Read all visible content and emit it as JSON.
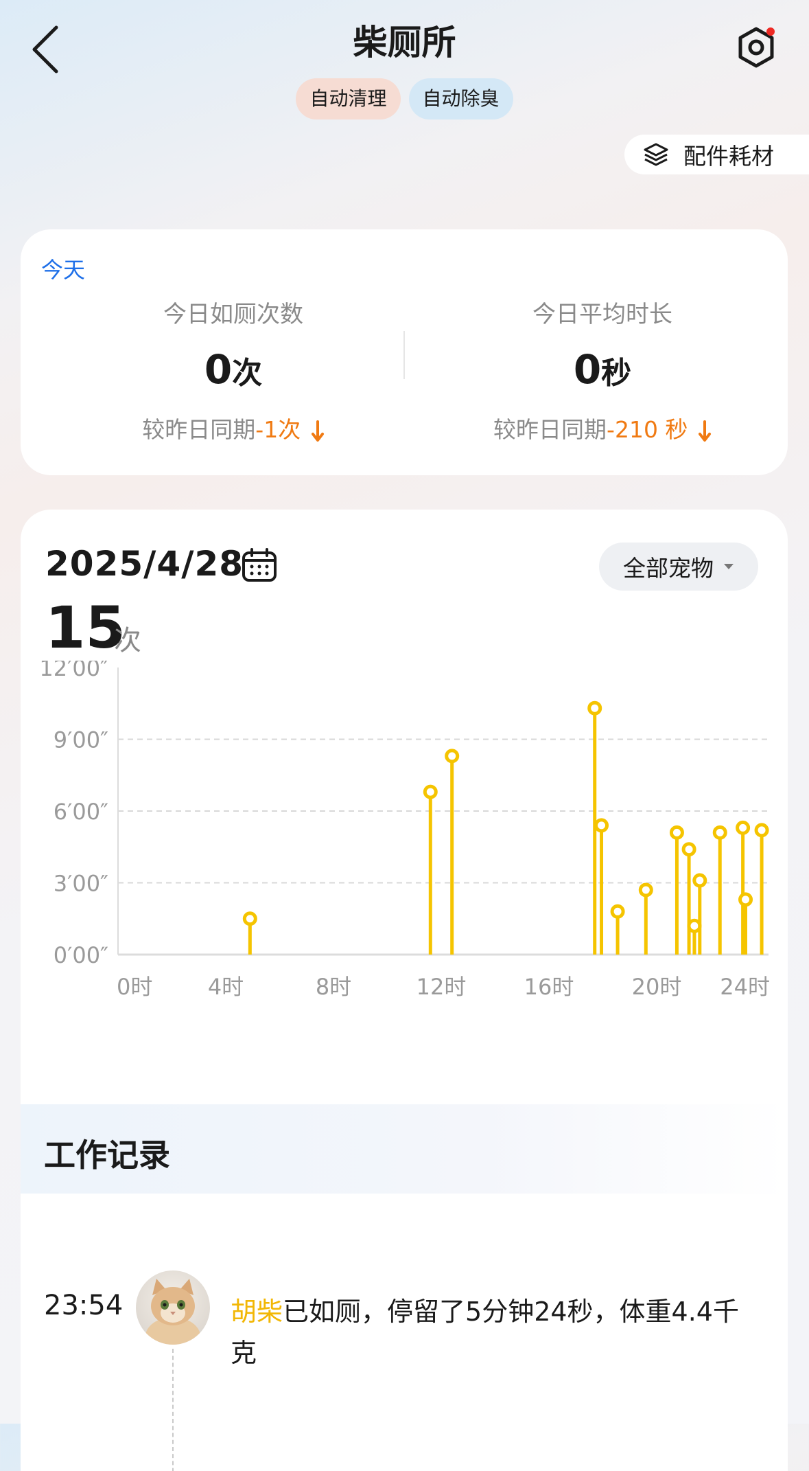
{
  "header": {
    "title": "柴厕所",
    "tags": [
      "自动清理",
      "自动除臭"
    ],
    "accessory_label": "配件耗材",
    "colors": {
      "notification_dot": "#ee2a24"
    }
  },
  "today": {
    "label": "今天",
    "visits_title": "今日如厕次数",
    "visits_value": "0",
    "visits_unit": "次",
    "visits_compare_prefix": "较昨日同期",
    "visits_compare_delta": "-1次",
    "duration_title": "今日平均时长",
    "duration_value": "0",
    "duration_unit": "秒",
    "duration_compare_prefix": "较昨日同期",
    "duration_compare_delta": "-210 秒",
    "colors": {
      "label": "#1e6fe8",
      "delta": "#f07a12"
    }
  },
  "chart_card": {
    "date": "2025/4/28",
    "pet_filter": "全部宠物",
    "count_value": "15",
    "count_unit": "次"
  },
  "chart_data": {
    "type": "scatter",
    "style": "lollipop",
    "x_ticks": [
      "0时",
      "4时",
      "8时",
      "12时",
      "16时",
      "20时",
      "24时"
    ],
    "y_ticks": [
      "0′00″",
      "3′00″",
      "6′00″",
      "9′00″",
      "12′00″"
    ],
    "xlim": [
      0,
      24
    ],
    "ylim": [
      0,
      12
    ],
    "x_unit": "hour",
    "y_unit": "minute",
    "grid": "horizontal dashed",
    "color": "#f5c400",
    "points": [
      {
        "x": 4.9,
        "y": 1.5
      },
      {
        "x": 11.6,
        "y": 6.8
      },
      {
        "x": 12.4,
        "y": 8.3
      },
      {
        "x": 17.7,
        "y": 10.3
      },
      {
        "x": 17.95,
        "y": 5.4
      },
      {
        "x": 18.55,
        "y": 1.8
      },
      {
        "x": 19.6,
        "y": 2.7
      },
      {
        "x": 20.75,
        "y": 5.1
      },
      {
        "x": 21.2,
        "y": 4.4
      },
      {
        "x": 21.4,
        "y": 1.2
      },
      {
        "x": 21.6,
        "y": 3.1
      },
      {
        "x": 22.35,
        "y": 5.1
      },
      {
        "x": 23.2,
        "y": 5.3
      },
      {
        "x": 23.3,
        "y": 2.3
      },
      {
        "x": 23.9,
        "y": 5.2
      }
    ]
  },
  "records": {
    "title": "工作记录",
    "items": [
      {
        "time": "23:54",
        "pet_name": "胡柴",
        "message": "已如厕，停留了5分钟24秒，体重4.4千克"
      }
    ]
  }
}
